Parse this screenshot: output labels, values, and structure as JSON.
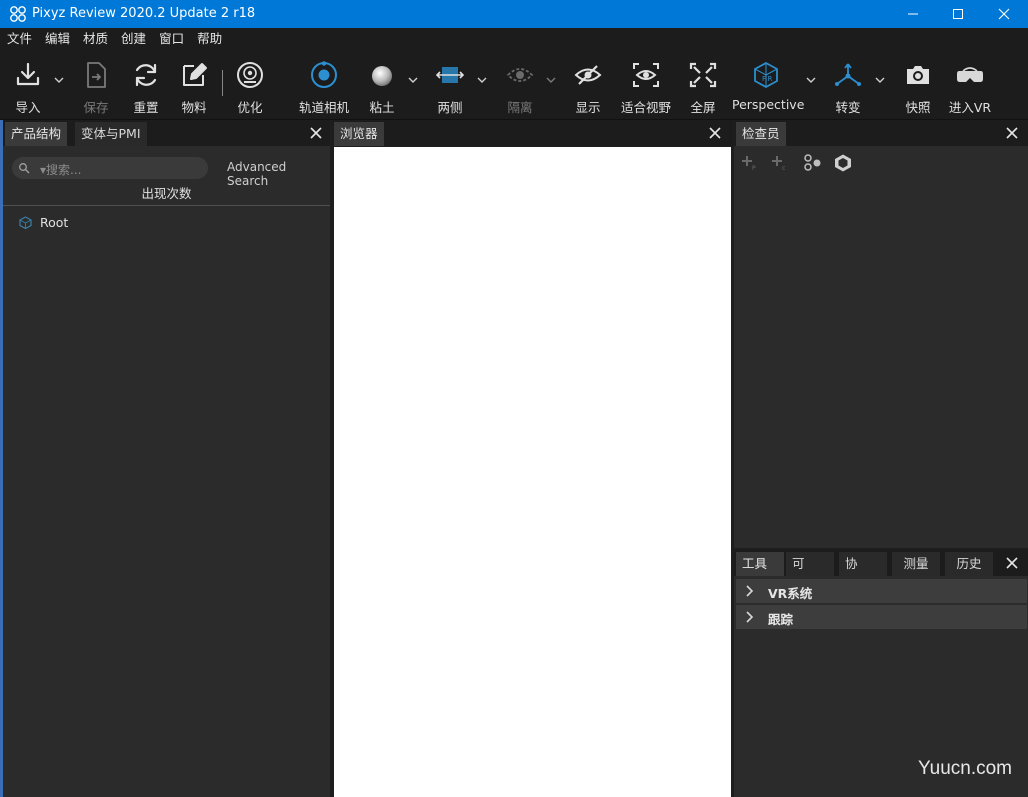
{
  "window": {
    "title": "Pixyz Review 2020.2 Update 2 r18",
    "title_bar_color": "#0078d7"
  },
  "menu": [
    "文件",
    "编辑",
    "材质",
    "创建",
    "窗口",
    "帮助"
  ],
  "toolbar": {
    "import": "导入",
    "save": "保存",
    "reset": "重置",
    "material": "物料",
    "optimize": "优化",
    "orbit_camera": "轨道相机",
    "clay": "粘土",
    "both_sides": "两侧",
    "isolate": "隔离",
    "show": "显示",
    "fit_view": "适合视野",
    "fullscreen": "全屏",
    "perspective": "Perspective",
    "transform": "转变",
    "snapshot": "快照",
    "enter_vr": "进入VR",
    "accent_color": "#2b8fd0"
  },
  "left_panel": {
    "tabs": [
      "产品结构",
      "变体与PMI"
    ],
    "search_placeholder": "▾搜索...",
    "advanced_search": "Advanced Search",
    "column_header": "出现次数",
    "tree": [
      {
        "label": "Root"
      }
    ]
  },
  "viewer_panel": {
    "tab": "浏览器",
    "background": "#ffffff"
  },
  "inspector_panel": {
    "tab": "检查员"
  },
  "tools_panel": {
    "tabs": [
      "工具",
      "可视...",
      "协同...",
      "测量",
      "历史"
    ],
    "items": [
      {
        "label": "VR系统"
      },
      {
        "label": "跟踪"
      }
    ]
  },
  "watermark": "Yuucn.com"
}
